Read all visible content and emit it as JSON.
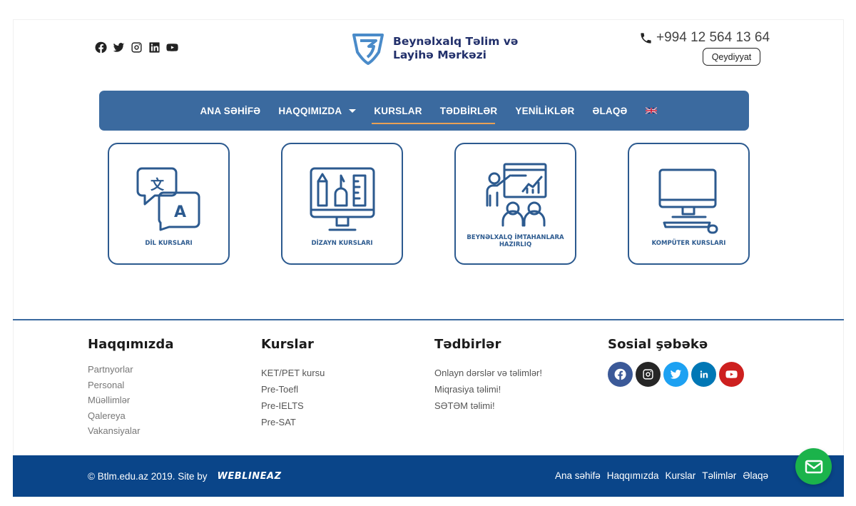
{
  "header": {
    "logo_line1": "Beynəlxalq Təlim və",
    "logo_line2": "Layihə Mərkəzi",
    "phone": "+994 12 564 13 64",
    "register_label": "Qeydiyyat",
    "social_icons": [
      "facebook-icon",
      "twitter-icon",
      "instagram-icon",
      "linkedin-icon",
      "youtube-icon"
    ]
  },
  "nav": {
    "items": [
      {
        "label": "ANA SƏHİFƏ"
      },
      {
        "label": "HAQQIMIZDA"
      },
      {
        "label": "KURSLAR"
      },
      {
        "label": "TƏDBİRLƏR"
      },
      {
        "label": "YENİLİKLƏR"
      },
      {
        "label": "ƏLAQƏ"
      }
    ],
    "language_icon": "uk-flag-icon"
  },
  "cards": [
    {
      "label": "DİL KURSLARI",
      "icon": "language-translate-icon"
    },
    {
      "label": "DİZAYN KURSLARI",
      "icon": "design-tools-icon"
    },
    {
      "label": "BEYNƏLXALQ İMTAHANLARA HAZIRLIQ",
      "icon": "presentation-icon"
    },
    {
      "label": "KOMPÜTER KURSLARI",
      "icon": "computer-icon"
    }
  ],
  "footer": {
    "about": {
      "title": "Haqqımızda",
      "items": [
        "Partnyorlar",
        "Personal",
        "Müəllimlər",
        "Qalereya",
        "Vakansiyalar"
      ]
    },
    "courses": {
      "title": "Kurslar",
      "items": [
        "KET/PET kursu",
        "Pre-Toefl",
        "Pre-IELTS",
        "Pre-SAT"
      ]
    },
    "events": {
      "title": "Tədbirlər",
      "items": [
        "Onlayn dərslər və təlimlər!",
        "Miqrasiya təlimi!",
        "SƏTƏM təlimi!"
      ]
    },
    "social": {
      "title": "Sosial şəbəkə",
      "colors": {
        "facebook": "#3b5998",
        "instagram": "#262626",
        "twitter": "#1da1f2",
        "linkedin": "#0077b5",
        "youtube": "#cd201f"
      }
    }
  },
  "bottom": {
    "copyright": "© Btlm.edu.az 2019. Site by",
    "brand": "WEBLINEAZ",
    "links": [
      "Ana səhifə",
      "Haqqımızda",
      "Kurslar",
      "Təlimlər",
      "Əlaqə"
    ]
  },
  "colors": {
    "nav_bg": "#3b6a9f",
    "accent_underline": "#e8a055",
    "bottom_bar": "#0a4589",
    "card_border": "#2c5a8f",
    "mail_fab": "#1bb34b"
  }
}
